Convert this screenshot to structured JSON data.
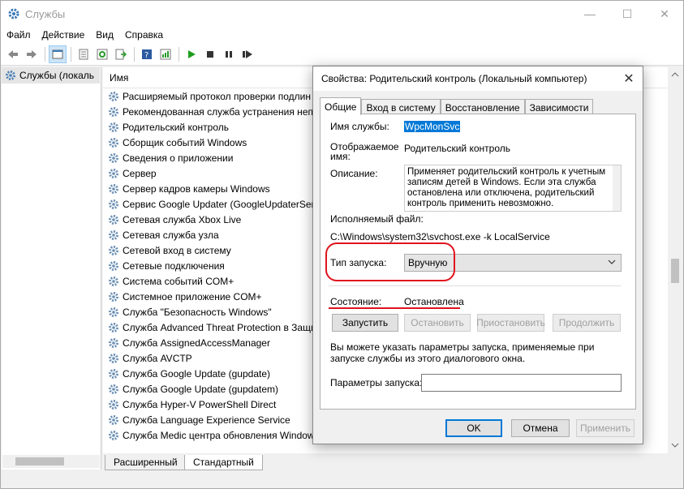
{
  "window": {
    "title": "Службы",
    "icon": "gear-icon"
  },
  "menu": [
    "Файл",
    "Действие",
    "Вид",
    "Справка"
  ],
  "tree": {
    "item": "Службы (локаль"
  },
  "list": {
    "column": "Имя",
    "rows": [
      "Расширяемый протокол проверки подлин",
      "Рекомендованная служба устранения непо",
      "Родительский контроль",
      "Сборщик событий Windows",
      "Сведения о приложении",
      "Сервер",
      "Сервер кадров камеры Windows",
      "Сервис Google Updater (GoogleUpdaterServ",
      "Сетевая служба Xbox Live",
      "Сетевая служба узла",
      "Сетевой вход в систему",
      "Сетевые подключения",
      "Система событий COM+",
      "Системное приложение COM+",
      "Служба \"Безопасность Windows\"",
      "Служба Advanced Threat Protection в Защи",
      "Служба AssignedAccessManager",
      "Служба AVCTP",
      "Служба Google Update (gupdate)",
      "Служба Google Update (gupdatem)",
      "Служба Hyper-V PowerShell Direct",
      "Служба Language Experience Service",
      "Служба Medic центра обновления Window"
    ]
  },
  "bottom_tabs": [
    "Расширенный",
    "Стандартный"
  ],
  "dialog": {
    "title": "Свойства: Родительский контроль (Локальный компьютер)",
    "tabs": [
      "Общие",
      "Вход в систему",
      "Восстановление",
      "Зависимости"
    ],
    "service_name_label": "Имя службы:",
    "service_name": "WpcMonSvc",
    "display_name_label_1": "Отображаемое",
    "display_name_label_2": "имя:",
    "display_name": "Родительский контроль",
    "description_label": "Описание:",
    "description": "Применяет родительский контроль к учетным записям детей в Windows. Если эта служба остановлена или отключена, родительский контроль применить невозможно.",
    "exe_label": "Исполняемый файл:",
    "exe_path": "C:\\Windows\\system32\\svchost.exe -k LocalService",
    "startup_label": "Тип запуска:",
    "startup_value": "Вручную",
    "state_label": "Состояние:",
    "state_value": "Остановлена",
    "buttons": {
      "start": "Запустить",
      "stop": "Остановить",
      "pause": "Приостановить",
      "resume": "Продолжить"
    },
    "hint": "Вы можете указать параметры запуска, применяемые при запуске службы из этого диалогового окна.",
    "params_label": "Параметры запуска:",
    "params_value": "",
    "ok": "OK",
    "cancel": "Отмена",
    "apply": "Применить"
  }
}
